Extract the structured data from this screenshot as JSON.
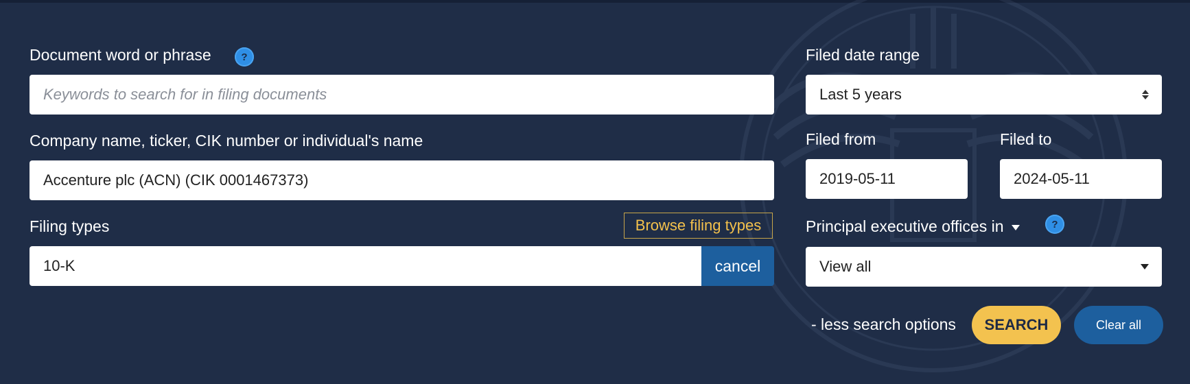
{
  "left": {
    "document_label": "Document word or phrase",
    "document_placeholder": "Keywords to search for in filing documents",
    "company_label": "Company name, ticker, CIK number or individual's name",
    "company_value": "Accenture plc (ACN) (CIK 0001467373)",
    "filing_types_label": "Filing types",
    "browse_label": "Browse filing types",
    "filing_types_value": "10-K",
    "cancel_label": "cancel"
  },
  "right": {
    "date_range_label": "Filed date range",
    "date_range_value": "Last 5 years",
    "filed_from_label": "Filed from",
    "filed_from_value": "2019-05-11",
    "filed_to_label": "Filed to",
    "filed_to_value": "2024-05-11",
    "offices_label": "Principal executive offices in",
    "offices_value": "View all"
  },
  "help_glyph": "?",
  "actions": {
    "less_options_label": "- less search options",
    "search_label": "SEARCH",
    "clear_label": "Clear all"
  },
  "colors": {
    "background": "#1f2d47",
    "accent_yellow": "#f3c24f",
    "accent_blue": "#1d5f9e",
    "help_blue": "#2f8fe6"
  },
  "icons": {
    "help": "question-circle-icon",
    "select": "updown-arrows-icon",
    "dropdown": "caret-down-icon",
    "seal": "eagle-seal-watermark"
  }
}
